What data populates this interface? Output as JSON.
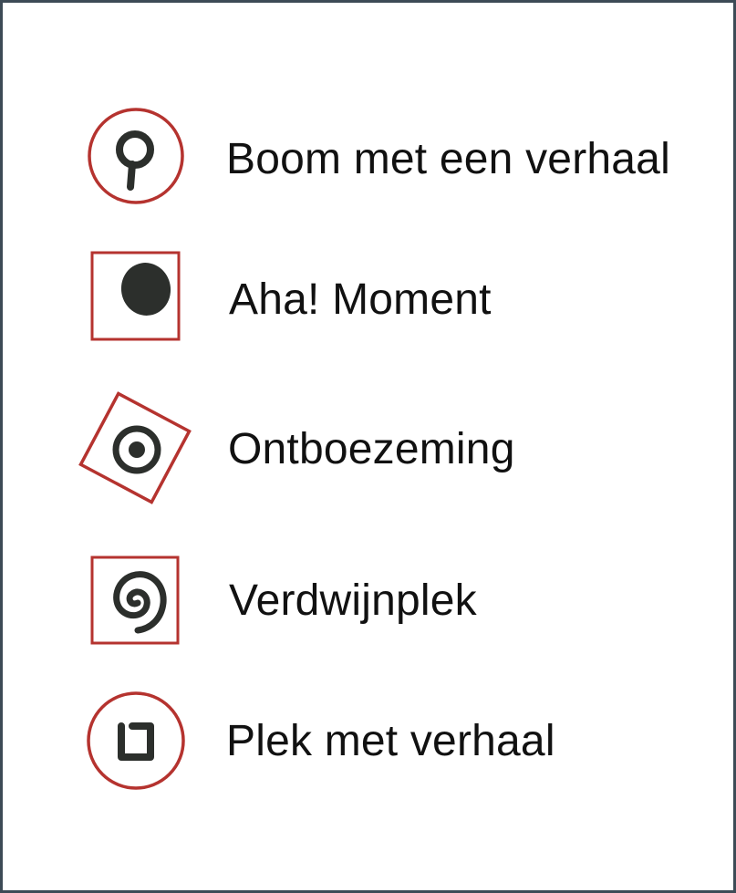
{
  "legend": {
    "items": [
      {
        "label": "Boom met een verhaal",
        "icon": "circled-lollipop-icon"
      },
      {
        "label": "Aha! Moment",
        "icon": "boxed-dot-icon"
      },
      {
        "label": "Ontboezeming",
        "icon": "diamond-target-icon"
      },
      {
        "label": "Verdwijnplek",
        "icon": "boxed-spiral-icon"
      },
      {
        "label": "Plek met verhaal",
        "icon": "circled-square-icon"
      }
    ]
  },
  "colors": {
    "frame_border": "#3d4b56",
    "symbol_outline": "#b5332f",
    "symbol_ink": "#2c2f2c",
    "text": "#111111"
  }
}
